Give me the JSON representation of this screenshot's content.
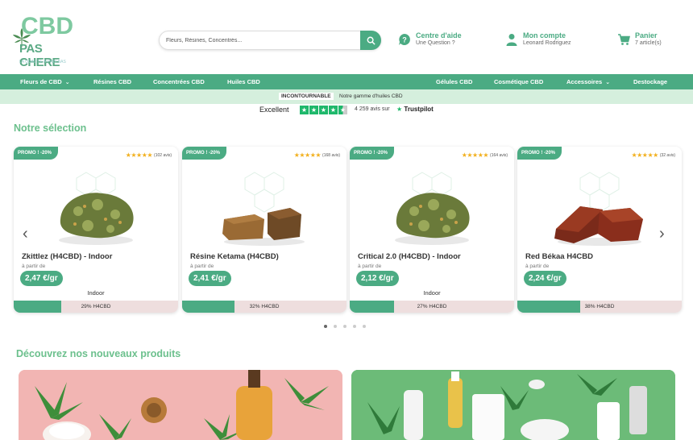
{
  "header": {
    "logo": {
      "line1": "CBD",
      "line2": "PAS CHERE",
      "suffix": ".com",
      "tagline": "LA QUALITÉ À PRIX BAS"
    },
    "search": {
      "placeholder": "Fleurs, Résines, Concentrés..."
    },
    "help": {
      "title": "Centre d'aide",
      "subtitle": "Une Question ?"
    },
    "account": {
      "title": "Mon compte",
      "subtitle": "Leonard Rodriguez"
    },
    "cart": {
      "title": "Panier",
      "subtitle": "7 article(s)"
    }
  },
  "nav": {
    "items": [
      {
        "label": "Fleurs de CBD",
        "dropdown": true
      },
      {
        "label": "Résines CBD"
      },
      {
        "label": "Concentrées CBD"
      },
      {
        "label": "Huiles CBD"
      },
      {
        "label": "Gélules CBD"
      },
      {
        "label": "Cosmétique CBD"
      },
      {
        "label": "Accessoires",
        "dropdown": true
      },
      {
        "label": "Destockage"
      }
    ]
  },
  "promo_bar": {
    "tag": "INCONTOURNABLE",
    "text": "Notre gamme d'huiles CBD"
  },
  "trustpilot": {
    "label": "Excellent",
    "count": "4 259 avis sur",
    "brand": "Trustpilot"
  },
  "selection": {
    "title": "Notre sélection",
    "products": [
      {
        "badge": "PROMO ! -20%",
        "stars": "★★★★★",
        "reviews": "(102 avis)",
        "name": "Zkittlez (H4CBD) - Indoor",
        "from": "à partir de",
        "price": "2,47 €/gr",
        "variant": "Indoor",
        "percent_label": "29% H4CBD",
        "percent": 29,
        "image": "flower"
      },
      {
        "badge": "PROMO ! -20%",
        "stars": "★★★★★",
        "reviews": "(168 avis)",
        "name": "Résine Ketama (H4CBD)",
        "from": "à partir de",
        "price": "2,41 €/gr",
        "variant": "",
        "percent_label": "32% H4CBD",
        "percent": 32,
        "image": "resin-brown"
      },
      {
        "badge": "PROMO ! -20%",
        "stars": "★★★★★",
        "reviews": "(164 avis)",
        "name": "Critical 2.0 (H4CBD) - Indoor",
        "from": "à partir de",
        "price": "2,12 €/gr",
        "variant": "Indoor",
        "percent_label": "27% H4CBD",
        "percent": 27,
        "image": "flower"
      },
      {
        "badge": "PROMO ! -20%",
        "stars": "★★★★★",
        "reviews": "(32 avis)",
        "name": "Red Békaa H4CBD",
        "from": "à partir de",
        "price": "2,24 €/gr",
        "variant": "",
        "percent_label": "38% H4CBD",
        "percent": 38,
        "image": "resin-red"
      }
    ]
  },
  "new_products": {
    "title": "Découvrez nos nouveaux produits"
  },
  "colors": {
    "brand": "#4bab83",
    "title": "#6cc08d",
    "promo_bg": "#d5efdd",
    "bar_bg": "#eedede",
    "star": "#f2b01e",
    "trustpilot": "#1eb86b"
  }
}
